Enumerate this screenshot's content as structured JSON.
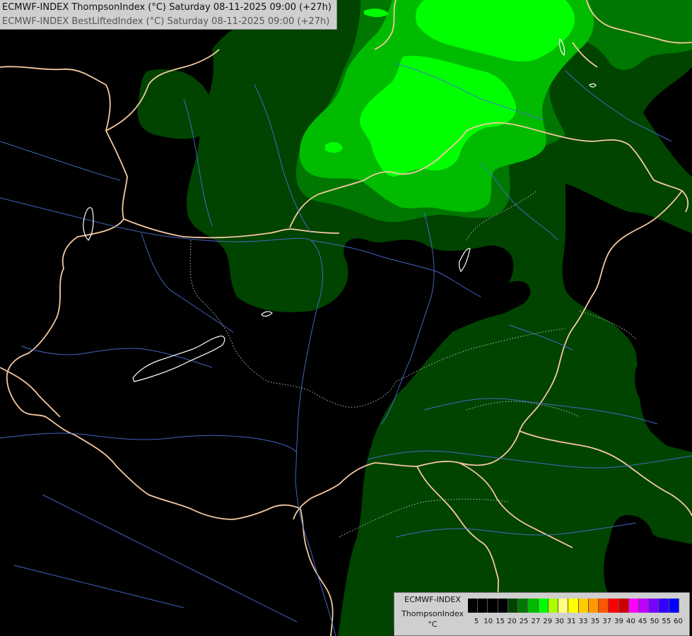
{
  "header": {
    "line1": "ECMWF-INDEX ThompsonIndex (°C) Saturday 08-11-2025 09:00 (+27h)",
    "line2": "ECMWF-INDEX BestLiftedIndex (°C) Saturday 08-11-2025 09:00 (+27h)"
  },
  "legend": {
    "model": "ECMWF-INDEX",
    "parameter": "ThompsonIndex",
    "unit": "°C",
    "ticks": [
      "5",
      "10",
      "15",
      "20",
      "25",
      "27",
      "29",
      "30",
      "31",
      "33",
      "35",
      "37",
      "39",
      "40",
      "45",
      "50",
      "55",
      "60"
    ],
    "colors": [
      "#000000",
      "#000000",
      "#000000",
      "#000000",
      "#004400",
      "#007700",
      "#00bb00",
      "#00ff00",
      "#aaff00",
      "#ffff80",
      "#ffff00",
      "#ffcc00",
      "#ff9900",
      "#ff5500",
      "#ff0000",
      "#cc0000",
      "#ff00ff",
      "#bb00ff",
      "#7700ff",
      "#3300ff",
      "#0000ff"
    ]
  },
  "map": {
    "colors": {
      "background": "#000000",
      "dark_green": "#004400",
      "medium_green": "#007700",
      "bright_green": "#00bb00",
      "lime": "#00ff00",
      "borders": "#f5c9a0",
      "rivers": "#4a6fd6",
      "lakes": "#ffffff"
    }
  }
}
